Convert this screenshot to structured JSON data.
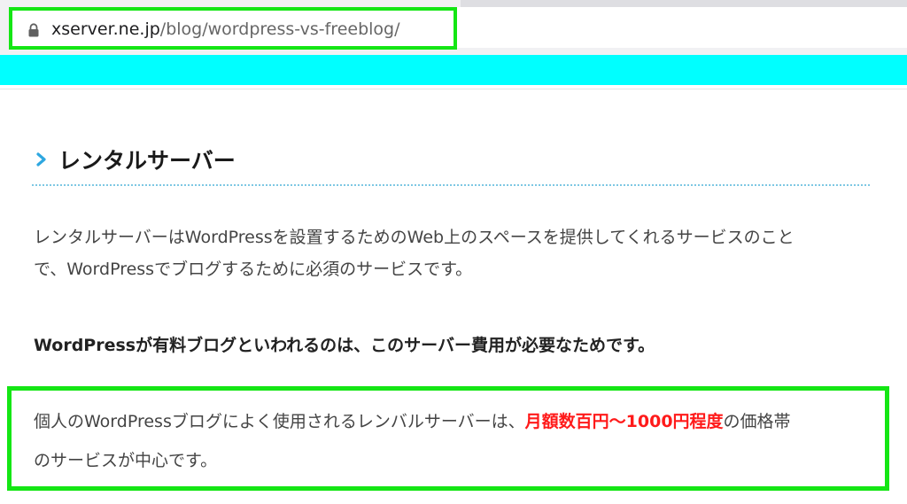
{
  "browser": {
    "url_domain": "xserver.ne.jp",
    "url_path": "/blog/wordpress-vs-freeblog/",
    "lock_icon": "lock-icon"
  },
  "colors": {
    "header_accent": "#00ffff",
    "highlight": "#14e614",
    "emphasis_red": "#ff1a1a",
    "heading_chevron": "#2ea7e0"
  },
  "article": {
    "heading": "レンタルサーバー",
    "heading_icon": "chevron-right-icon",
    "paragraph_line_1": "レンタルサーバーはWordPressを設置するためのWeb上のスペースを提供してくれるサービスのこと",
    "paragraph_line_2": "で、WordPressでブログするために必須のサービスです。",
    "bold_statement": "WordPressが有料ブログといわれるのは、このサーバー費用が必要なためです。",
    "highlight_line_1_before": "個人のWordPressブログによく使用されるレンバルサーバーは、",
    "highlight_line_1_emphasis": "月額数百円〜1000円程度",
    "highlight_line_1_after": "の価格帯",
    "highlight_line_2": "のサービスが中心です。"
  }
}
